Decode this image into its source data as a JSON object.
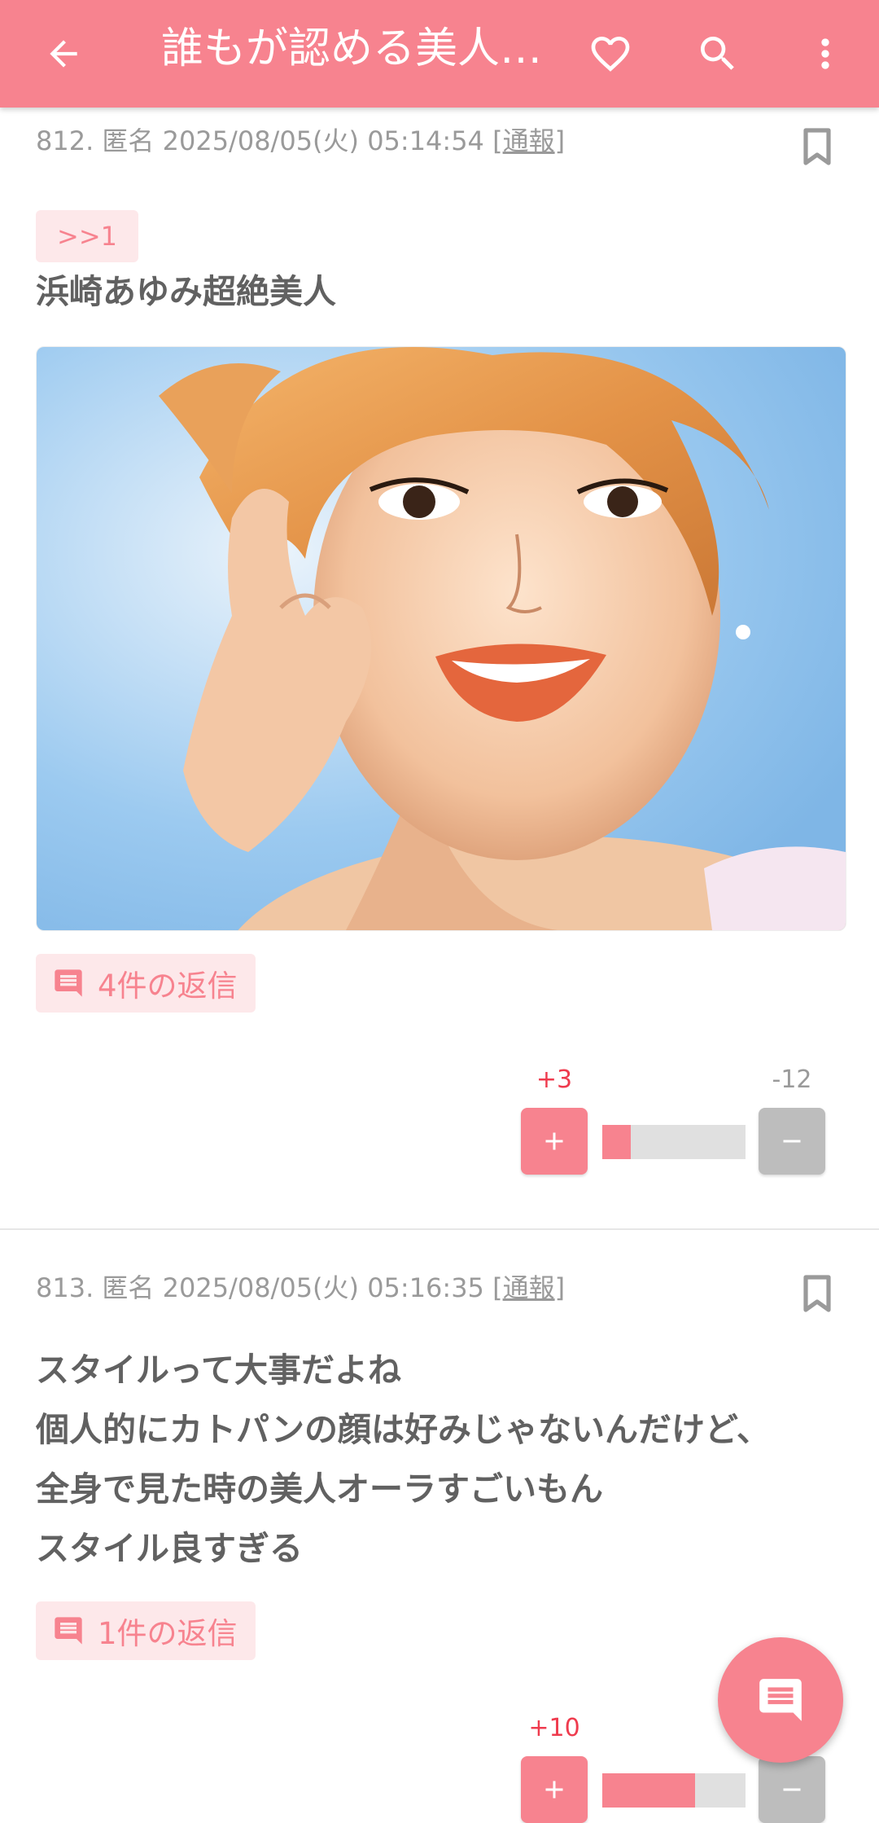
{
  "appbar": {
    "title": "誰もが認める美人…",
    "icons": [
      "back-arrow-icon",
      "heart-icon",
      "search-icon",
      "more-vert-icon"
    ]
  },
  "posts": [
    {
      "number": "812.",
      "author": "匿名",
      "datetime": "2025/08/05(火) 05:14:54",
      "report_open": "[",
      "report_label": "通報",
      "report_close": "]",
      "anchor": ">>1",
      "body": "浜崎あゆみ超絶美人",
      "has_image": true,
      "replies_label": "4件の返信",
      "plus_count": "+3",
      "minus_count": "-12",
      "plus_ratio": 0.2
    },
    {
      "number": "813.",
      "author": "匿名",
      "datetime": "2025/08/05(火) 05:16:35",
      "report_open": "[",
      "report_label": "通報",
      "report_close": "]",
      "body": "スタイルって大事だよね\n個人的にカトパンの顔は好みじゃないんだけど、\n全身で見た時の美人オーラすごいもん\nスタイル良すぎる",
      "replies_label": "1件の返信",
      "plus_count": "+10",
      "plus_ratio": 0.65
    }
  ],
  "colors": {
    "accent": "#f7838f",
    "accent_light": "#fde8ea",
    "plus_red": "#ef3b4e",
    "gray_text": "#9a9a9a"
  },
  "fab": {
    "icon": "comment-icon"
  }
}
